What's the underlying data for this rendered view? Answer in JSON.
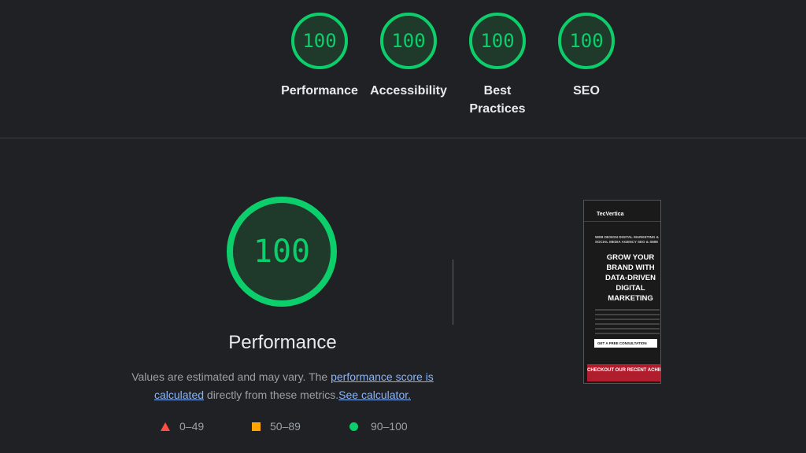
{
  "categories": [
    {
      "score": "100",
      "label": "Performance"
    },
    {
      "score": "100",
      "label": "Accessibility"
    },
    {
      "score": "100",
      "label": "Best\nPractices"
    },
    {
      "score": "100",
      "label": "SEO"
    }
  ],
  "performance": {
    "score": "100",
    "title": "Performance",
    "desc_prefix": "Values are estimated and may vary. The ",
    "link_score": "performance score is calculated",
    "desc_middle": " directly from these metrics.",
    "link_calculator": "See calculator."
  },
  "legend": [
    {
      "shape": "triangle",
      "range": "0–49",
      "color": "#ff4e42"
    },
    {
      "shape": "square",
      "range": "50–89",
      "color": "#ffa400"
    },
    {
      "shape": "circle",
      "range": "90–100",
      "color": "#0cce6b"
    }
  ],
  "screenshot": {
    "brand": "TecVertica",
    "subtitle": "WEB DESIGN DIGITAL MARKETING & SOCIAL MEDIA AGENCY SEO & SMM",
    "headline": "GROW YOUR\nBRAND WITH\nDATA-DRIVEN\nDIGITAL\nMARKETING",
    "cta": "GET A FREE CONSULTATION",
    "banner": "CHECKOUT OUR RECENT ACHIEVEMENTS"
  },
  "colors": {
    "pass": "#0cce6b",
    "average": "#ffa400",
    "fail": "#ff4e42",
    "link": "#8ab4f8"
  }
}
